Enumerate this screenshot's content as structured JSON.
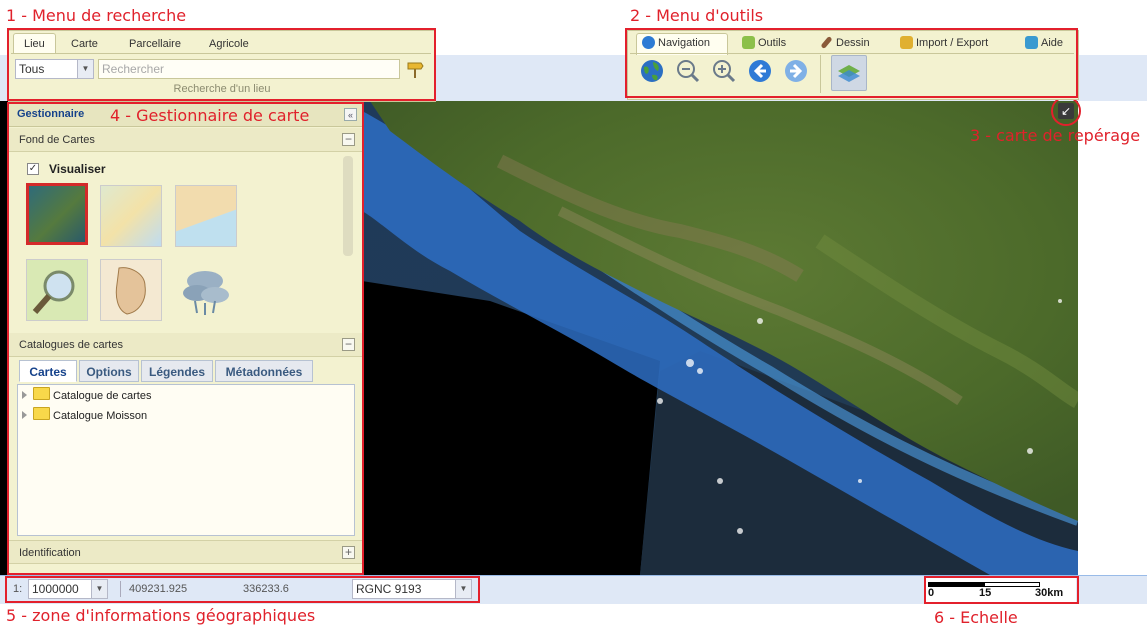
{
  "callouts": {
    "search_menu": "1 - Menu de recherche",
    "tools_menu": "2 - Menu d'outils",
    "overview_map": "3 - carte de repérage",
    "map_manager": "4 - Gestionnaire de carte",
    "geo_info": "5 - zone d'informations géographiques",
    "scale": "6 - Echelle"
  },
  "search": {
    "tabs": [
      "Lieu",
      "Carte",
      "Parcellaire",
      "Agricole"
    ],
    "active_tab": "Lieu",
    "filter_value": "Tous",
    "placeholder": "Rechercher",
    "footer": "Recherche d'un lieu"
  },
  "tools": {
    "tabs": [
      {
        "label": "Navigation",
        "icon": "globe-icon"
      },
      {
        "label": "Outils",
        "icon": "puzzle-icon"
      },
      {
        "label": "Dessin",
        "icon": "pencil-icon"
      },
      {
        "label": "Import / Export",
        "icon": "arrows-icon"
      },
      {
        "label": "Aide",
        "icon": "help-book-icon"
      }
    ],
    "active_tab": "Navigation",
    "buttons": [
      "full-extent-globe-icon",
      "zoom-out-icon",
      "zoom-in-icon",
      "previous-view-icon",
      "next-view-icon",
      "layers-icon"
    ]
  },
  "manager": {
    "title": "Gestionnaire",
    "basemap_section": "Fond de Cartes",
    "visualize_label": "Visualiser",
    "visualize_checked": true,
    "thumbnails": [
      "satellite",
      "topographic",
      "cadastral",
      "search-map",
      "island-map",
      "weather"
    ],
    "catalog_section": "Catalogues de cartes",
    "catalog_tabs": [
      "Cartes",
      "Options",
      "Légendes",
      "Métadonnées"
    ],
    "catalog_active_tab": "Cartes",
    "tree": [
      "Catalogue de cartes",
      "Catalogue Moisson"
    ],
    "identification": "Identification"
  },
  "info": {
    "scale_prefix": "1:",
    "scale_value": "1000000",
    "x": "409231.925",
    "y": "336233.6",
    "projection": "RGNC 9193"
  },
  "scalebar": {
    "labels": [
      "0",
      "15",
      "30km"
    ]
  },
  "colors": {
    "callout": "#e0212b",
    "panel_bg": "#f3f2d0",
    "band_bg": "#dfe8f6"
  }
}
